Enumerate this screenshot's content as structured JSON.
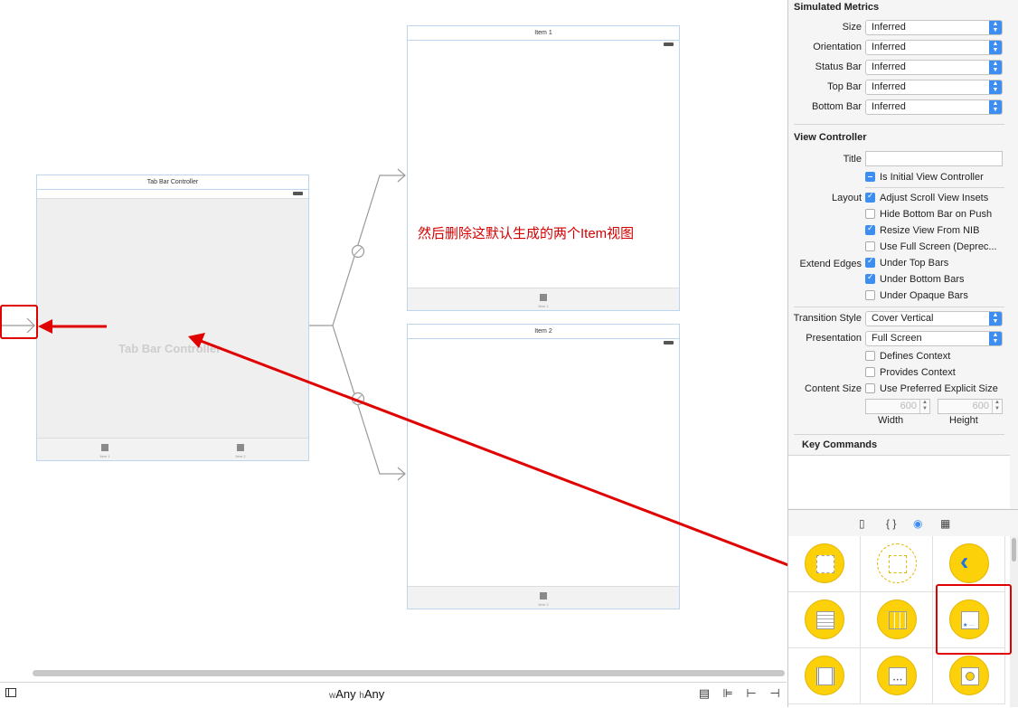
{
  "canvas": {
    "tab_bar_controller": {
      "title": "Tab Bar Controller",
      "center_label": "Tab Bar Controller",
      "tabs": [
        "Item 1",
        "Item 2"
      ]
    },
    "item1_scene": {
      "title": "Item 1",
      "tab": "Item 1"
    },
    "item2_scene": {
      "title": "Item 2",
      "tab": "Item 2"
    },
    "annotation": "然后删除这默认生成的两个Item视图"
  },
  "bottom_bar": {
    "width_prefix": "w",
    "width_value": "Any",
    "height_prefix": "h",
    "height_value": "Any"
  },
  "inspector": {
    "simulated_metrics": {
      "title": "Simulated Metrics",
      "rows": [
        {
          "label": "Size",
          "value": "Inferred"
        },
        {
          "label": "Orientation",
          "value": "Inferred"
        },
        {
          "label": "Status Bar",
          "value": "Inferred"
        },
        {
          "label": "Top Bar",
          "value": "Inferred"
        },
        {
          "label": "Bottom Bar",
          "value": "Inferred"
        }
      ]
    },
    "view_controller": {
      "title": "View Controller",
      "title_label": "Title",
      "title_value": "",
      "initial_vc": "Is Initial View Controller",
      "layout_label": "Layout",
      "adjust_scroll": "Adjust Scroll View Insets",
      "hide_bottom_bar": "Hide Bottom Bar on Push",
      "resize_nib": "Resize View From NIB",
      "use_full_screen": "Use Full Screen (Deprec...",
      "extend_edges_label": "Extend Edges",
      "under_top": "Under Top Bars",
      "under_bottom": "Under Bottom Bars",
      "under_opaque": "Under Opaque Bars",
      "transition_label": "Transition Style",
      "transition_value": "Cover Vertical",
      "presentation_label": "Presentation",
      "presentation_value": "Full Screen",
      "defines_context": "Defines Context",
      "provides_context": "Provides Context",
      "content_size_label": "Content Size",
      "preferred_size": "Use Preferred Explicit Size",
      "width_value": "600",
      "height_value": "600",
      "width_label": "Width",
      "height_label": "Height"
    },
    "key_commands": {
      "title": "Key Commands"
    }
  },
  "colors": {
    "accent": "#3d8ef0",
    "annotation": "#d40000",
    "object_yellow": "#fcd10a"
  }
}
